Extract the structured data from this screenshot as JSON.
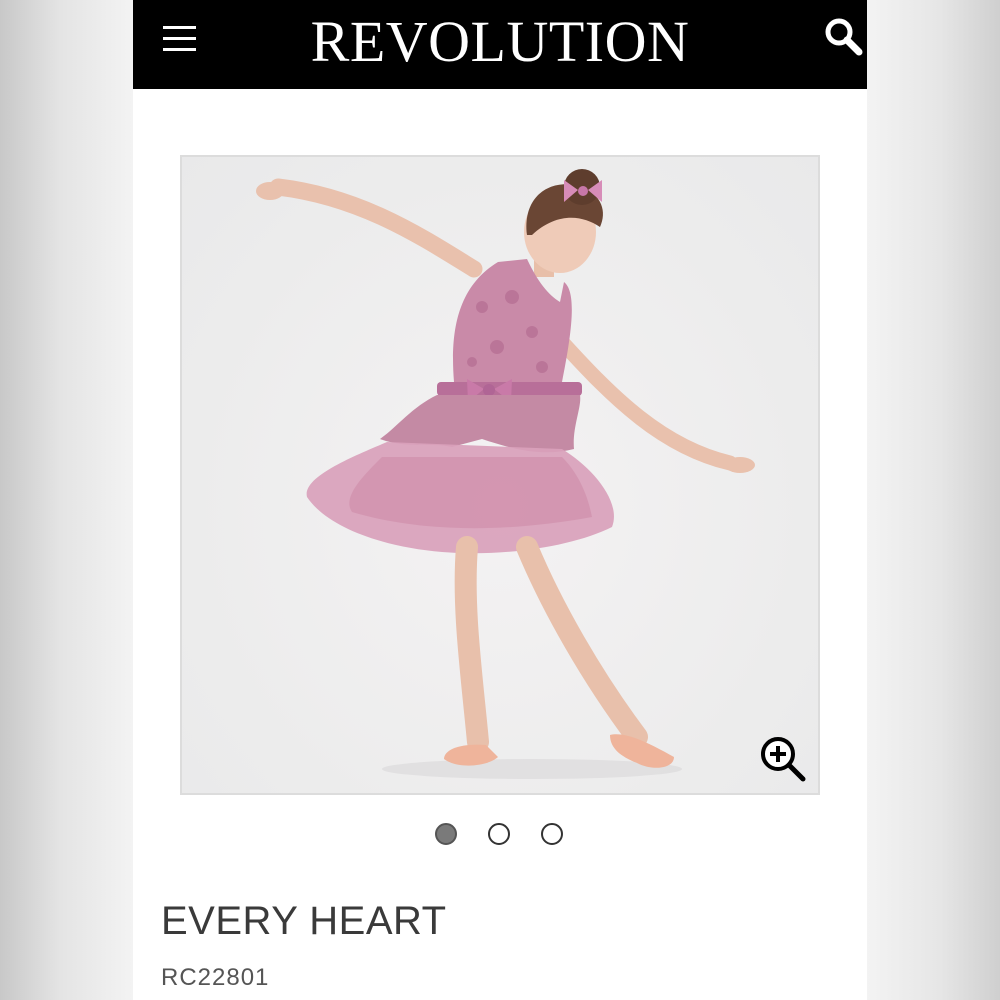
{
  "header": {
    "brand": "REVOLUTION",
    "menu_icon": "hamburger-menu-icon",
    "search_icon": "search-icon",
    "background": "#000000",
    "text_color": "#ffffff"
  },
  "gallery": {
    "image_description_icon": "product-photo",
    "zoom_icon": "zoom-in-icon",
    "slide_count": 3,
    "active_slide": 1,
    "dress_color": "#c98aa8",
    "tutu_color": "#d9a1bb"
  },
  "product": {
    "title": "EVERY HEART",
    "sku": "RC22801"
  }
}
